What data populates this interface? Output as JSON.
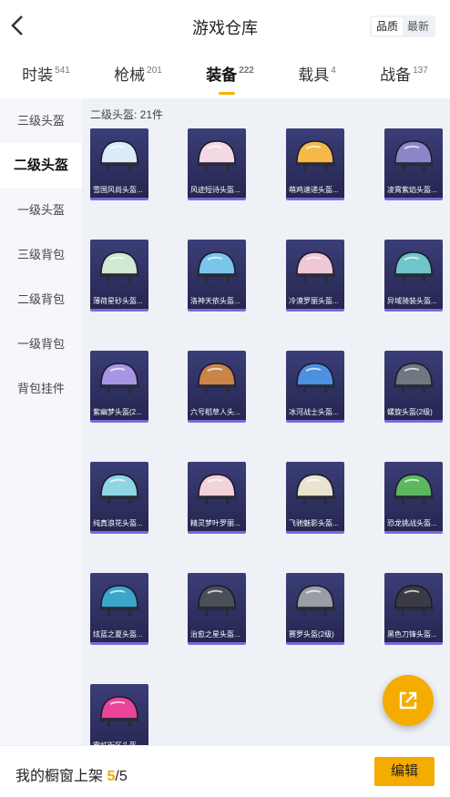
{
  "header": {
    "title": "游戏仓库",
    "back_icon": "chevron-left-icon",
    "sort_options": [
      "品质",
      "最新"
    ],
    "active_sort": "品质"
  },
  "tabs": [
    {
      "label": "时装",
      "count": "541"
    },
    {
      "label": "枪械",
      "count": "201"
    },
    {
      "label": "装备",
      "count": "222"
    },
    {
      "label": "载具",
      "count": "4"
    },
    {
      "label": "战备",
      "count": "137"
    }
  ],
  "active_tab": 2,
  "sidebar": {
    "items": [
      "三级头盔",
      "二级头盔",
      "一级头盔",
      "三级背包",
      "二级背包",
      "一级背包",
      "背包挂件"
    ],
    "active": 1
  },
  "content": {
    "count_label": "二级头盔: 21件"
  },
  "items": [
    {
      "name": "雪国风尚头盔...",
      "color": "#d9ecf7"
    },
    {
      "name": "风迹短诗头盔...",
      "color": "#f4d9e4"
    },
    {
      "name": "萌鸡速递头盔...",
      "color": "#f5b94a"
    },
    {
      "name": "凌霄紫焰头盔...",
      "color": "#8b86c9"
    },
    {
      "name": "薄荷星砂头盔...",
      "color": "#cfe9d4"
    },
    {
      "name": "洛神天依头盔...",
      "color": "#79c6ea"
    },
    {
      "name": "冷漠罗丽头盔...",
      "color": "#f0c8d4"
    },
    {
      "name": "异域骑装头盔...",
      "color": "#6fc5c9"
    },
    {
      "name": "紫幽梦头盔(2...",
      "color": "#a995e5"
    },
    {
      "name": "六号稻草人头...",
      "color": "#c9844a"
    },
    {
      "name": "冰河战士头盔...",
      "color": "#4d8fe0"
    },
    {
      "name": "螺旋头盔(2级)",
      "color": "#707780"
    },
    {
      "name": "纯真浪花头盔...",
      "color": "#8fd6e3"
    },
    {
      "name": "精灵梦叶罗丽...",
      "color": "#f2d3d9"
    },
    {
      "name": "飞驰魅影头盔...",
      "color": "#e9e4d0"
    },
    {
      "name": "恐龙挑战头盔...",
      "color": "#5bb85e"
    },
    {
      "name": "炫蓝之夏头盔...",
      "color": "#3aa6c9"
    },
    {
      "name": "治愈之星头盔...",
      "color": "#4a4f58"
    },
    {
      "name": "赛罗头盔(2级)",
      "color": "#999ea5"
    },
    {
      "name": "黑色刀锋头盔...",
      "color": "#3b3b46"
    },
    {
      "name": "霓虹街区头盔...",
      "color": "#e8459a"
    }
  ],
  "fab": {
    "icon": "share-icon"
  },
  "footer": {
    "label_prefix": "我的橱窗上架",
    "shown": "5",
    "separator": "/",
    "total": "5",
    "edit_label": "编辑"
  }
}
